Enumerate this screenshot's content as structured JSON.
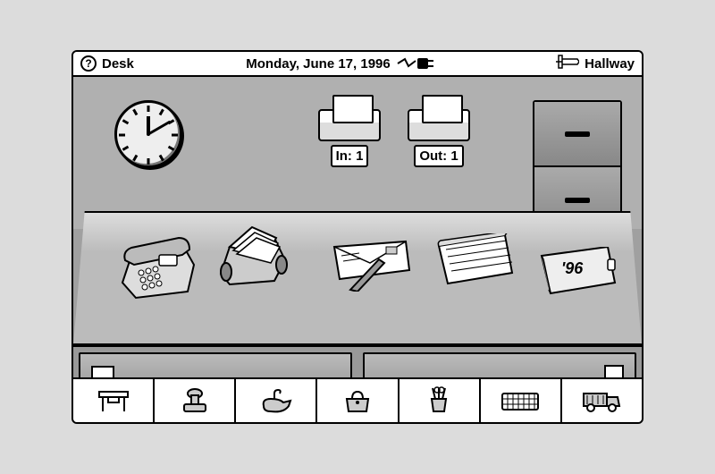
{
  "titlebar": {
    "location": "Desk",
    "date": "Monday, June 17, 1996",
    "nav_label": "Hallway"
  },
  "mail": {
    "in_label": "In: 1",
    "out_label": "Out: 1"
  },
  "planner": {
    "year_label": "'96"
  },
  "toolbar": {
    "items": [
      "desk",
      "stamp",
      "lamp",
      "bag",
      "tools",
      "keyboard",
      "truck"
    ]
  }
}
